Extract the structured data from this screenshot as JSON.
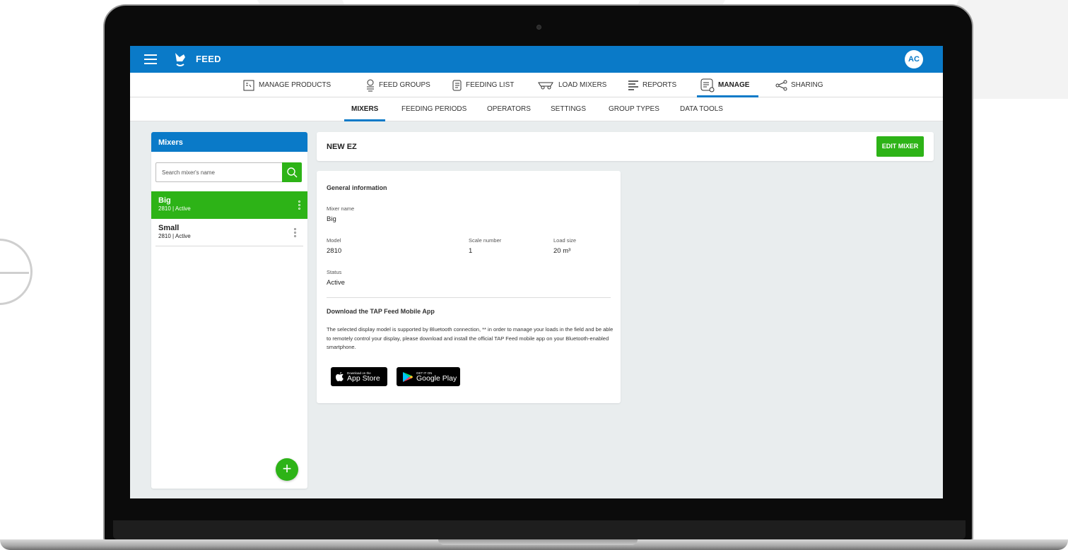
{
  "app": {
    "title": "FEED",
    "avatar_initials": "AC",
    "accent_color": "#0a7ac8",
    "action_color": "#2db317"
  },
  "main_nav": {
    "items": [
      {
        "label": "MANAGE PRODUCTS",
        "icon": "product-book-icon"
      },
      {
        "label": "FEED GROUPS",
        "icon": "cow-group-icon"
      },
      {
        "label": "FEEDING LIST",
        "icon": "list-pencil-icon"
      },
      {
        "label": "LOAD MIXERS",
        "icon": "mixer-wagon-icon"
      },
      {
        "label": "REPORTS",
        "icon": "report-icon"
      },
      {
        "label": "MANAGE",
        "icon": "manage-gear-icon",
        "active": true
      },
      {
        "label": "SHARING",
        "icon": "share-icon"
      }
    ]
  },
  "sub_nav": {
    "items": [
      {
        "label": "MIXERS",
        "active": true
      },
      {
        "label": "FEEDING PERIODS"
      },
      {
        "label": "OPERATORS"
      },
      {
        "label": "SETTINGS"
      },
      {
        "label": "GROUP TYPES"
      },
      {
        "label": "DATA TOOLS"
      }
    ]
  },
  "sidebar": {
    "title": "Mixers",
    "search_placeholder": "Search mixer's name",
    "items": [
      {
        "name": "Big",
        "sub": "2810 | Active",
        "selected": true
      },
      {
        "name": "Small",
        "sub": "2810 | Active",
        "selected": false
      }
    ],
    "add_label": "+"
  },
  "detail": {
    "title": "NEW EZ",
    "edit_label": "EDIT MIXER",
    "general_heading": "General information",
    "mixer_name_label": "Mixer name",
    "mixer_name": "Big",
    "model_label": "Model",
    "model": "2810",
    "scale_label": "Scale number",
    "scale": "1",
    "load_label": "Load size",
    "load": "20 m³",
    "status_label": "Status",
    "status": "Active",
    "download_heading": "Download the TAP Feed Mobile App",
    "download_text": "The selected display model is supported by Bluetooth connection, ** in order to manage your loads in the field and be able to remotely control your display, please download and install the official TAP Feed mobile app on your Bluetooth-enabled smartphone.",
    "app_store": {
      "small": "Download on the",
      "big": "App Store"
    },
    "google_play": {
      "small": "GET IT ON",
      "big": "Google Play"
    }
  }
}
